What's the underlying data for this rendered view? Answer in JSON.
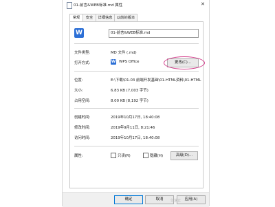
{
  "window": {
    "title": "01-前言&WEB标准.md 属性",
    "close_glyph": "✕"
  },
  "tabs": [
    {
      "label": "常规",
      "active": true
    },
    {
      "label": "安全",
      "active": false
    },
    {
      "label": "详细信息",
      "active": false
    },
    {
      "label": "以前的版本",
      "active": false
    }
  ],
  "file": {
    "name": "01-前言&WEB标准.md",
    "icon": "wps-icon"
  },
  "properties": {
    "type_label": "文件类型:",
    "type_value": "MD 文件 (.md)",
    "open_with_label": "打开方式:",
    "open_with_value": "WPS Office",
    "change_button": "更改(C)...",
    "location_label": "位置:",
    "location_value": "E:\\下载\\01-03 前端开发基础\\01-HTML资料\\01-HTML",
    "size_label": "大小:",
    "size_value": "6.83 KB (7,003 字节)",
    "disk_size_label": "占用空间:",
    "disk_size_value": "8.00 KB (8,192 字节)",
    "created_label": "创建时间:",
    "created_value": "2019年10月17日, 18:40:08",
    "modified_label": "修改时间:",
    "modified_value": "2019年9月11日, 8:21:46",
    "accessed_label": "访问时间:",
    "accessed_value": "2019年10月17日, 18:40:08",
    "attributes_label": "属性:",
    "readonly_label": "只读(R)",
    "hidden_label": "隐藏(H)",
    "advanced_button": "高级(D)..."
  },
  "footer": {
    "ok": "确定",
    "cancel": "取消",
    "apply": "应用(A)"
  },
  "watermark": "亿速云",
  "colors": {
    "annotation": "#d33b8a",
    "wps_blue": "#2c6fd6"
  }
}
